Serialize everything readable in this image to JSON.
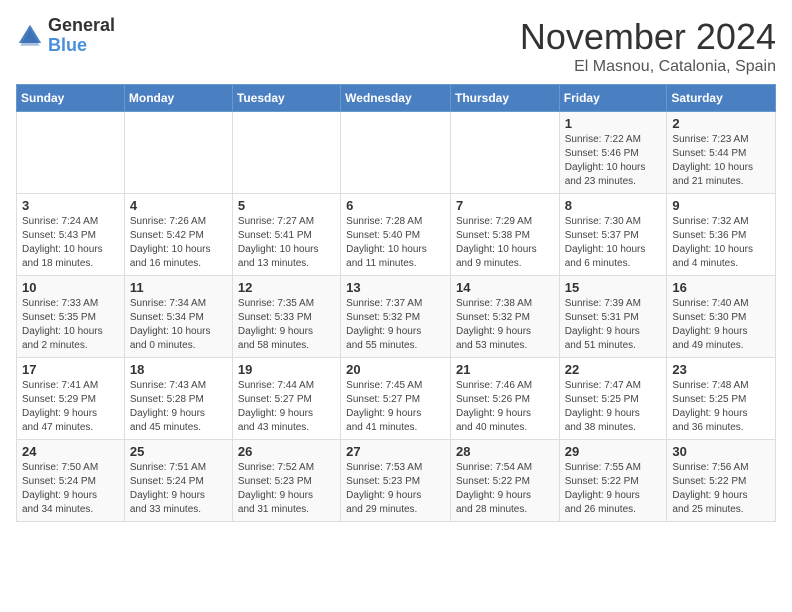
{
  "logo": {
    "line1": "General",
    "line2": "Blue"
  },
  "title": "November 2024",
  "location": "El Masnou, Catalonia, Spain",
  "days_header": [
    "Sunday",
    "Monday",
    "Tuesday",
    "Wednesday",
    "Thursday",
    "Friday",
    "Saturday"
  ],
  "weeks": [
    [
      {
        "day": "",
        "detail": ""
      },
      {
        "day": "",
        "detail": ""
      },
      {
        "day": "",
        "detail": ""
      },
      {
        "day": "",
        "detail": ""
      },
      {
        "day": "",
        "detail": ""
      },
      {
        "day": "1",
        "detail": "Sunrise: 7:22 AM\nSunset: 5:46 PM\nDaylight: 10 hours\nand 23 minutes."
      },
      {
        "day": "2",
        "detail": "Sunrise: 7:23 AM\nSunset: 5:44 PM\nDaylight: 10 hours\nand 21 minutes."
      }
    ],
    [
      {
        "day": "3",
        "detail": "Sunrise: 7:24 AM\nSunset: 5:43 PM\nDaylight: 10 hours\nand 18 minutes."
      },
      {
        "day": "4",
        "detail": "Sunrise: 7:26 AM\nSunset: 5:42 PM\nDaylight: 10 hours\nand 16 minutes."
      },
      {
        "day": "5",
        "detail": "Sunrise: 7:27 AM\nSunset: 5:41 PM\nDaylight: 10 hours\nand 13 minutes."
      },
      {
        "day": "6",
        "detail": "Sunrise: 7:28 AM\nSunset: 5:40 PM\nDaylight: 10 hours\nand 11 minutes."
      },
      {
        "day": "7",
        "detail": "Sunrise: 7:29 AM\nSunset: 5:38 PM\nDaylight: 10 hours\nand 9 minutes."
      },
      {
        "day": "8",
        "detail": "Sunrise: 7:30 AM\nSunset: 5:37 PM\nDaylight: 10 hours\nand 6 minutes."
      },
      {
        "day": "9",
        "detail": "Sunrise: 7:32 AM\nSunset: 5:36 PM\nDaylight: 10 hours\nand 4 minutes."
      }
    ],
    [
      {
        "day": "10",
        "detail": "Sunrise: 7:33 AM\nSunset: 5:35 PM\nDaylight: 10 hours\nand 2 minutes."
      },
      {
        "day": "11",
        "detail": "Sunrise: 7:34 AM\nSunset: 5:34 PM\nDaylight: 10 hours\nand 0 minutes."
      },
      {
        "day": "12",
        "detail": "Sunrise: 7:35 AM\nSunset: 5:33 PM\nDaylight: 9 hours\nand 58 minutes."
      },
      {
        "day": "13",
        "detail": "Sunrise: 7:37 AM\nSunset: 5:32 PM\nDaylight: 9 hours\nand 55 minutes."
      },
      {
        "day": "14",
        "detail": "Sunrise: 7:38 AM\nSunset: 5:32 PM\nDaylight: 9 hours\nand 53 minutes."
      },
      {
        "day": "15",
        "detail": "Sunrise: 7:39 AM\nSunset: 5:31 PM\nDaylight: 9 hours\nand 51 minutes."
      },
      {
        "day": "16",
        "detail": "Sunrise: 7:40 AM\nSunset: 5:30 PM\nDaylight: 9 hours\nand 49 minutes."
      }
    ],
    [
      {
        "day": "17",
        "detail": "Sunrise: 7:41 AM\nSunset: 5:29 PM\nDaylight: 9 hours\nand 47 minutes."
      },
      {
        "day": "18",
        "detail": "Sunrise: 7:43 AM\nSunset: 5:28 PM\nDaylight: 9 hours\nand 45 minutes."
      },
      {
        "day": "19",
        "detail": "Sunrise: 7:44 AM\nSunset: 5:27 PM\nDaylight: 9 hours\nand 43 minutes."
      },
      {
        "day": "20",
        "detail": "Sunrise: 7:45 AM\nSunset: 5:27 PM\nDaylight: 9 hours\nand 41 minutes."
      },
      {
        "day": "21",
        "detail": "Sunrise: 7:46 AM\nSunset: 5:26 PM\nDaylight: 9 hours\nand 40 minutes."
      },
      {
        "day": "22",
        "detail": "Sunrise: 7:47 AM\nSunset: 5:25 PM\nDaylight: 9 hours\nand 38 minutes."
      },
      {
        "day": "23",
        "detail": "Sunrise: 7:48 AM\nSunset: 5:25 PM\nDaylight: 9 hours\nand 36 minutes."
      }
    ],
    [
      {
        "day": "24",
        "detail": "Sunrise: 7:50 AM\nSunset: 5:24 PM\nDaylight: 9 hours\nand 34 minutes."
      },
      {
        "day": "25",
        "detail": "Sunrise: 7:51 AM\nSunset: 5:24 PM\nDaylight: 9 hours\nand 33 minutes."
      },
      {
        "day": "26",
        "detail": "Sunrise: 7:52 AM\nSunset: 5:23 PM\nDaylight: 9 hours\nand 31 minutes."
      },
      {
        "day": "27",
        "detail": "Sunrise: 7:53 AM\nSunset: 5:23 PM\nDaylight: 9 hours\nand 29 minutes."
      },
      {
        "day": "28",
        "detail": "Sunrise: 7:54 AM\nSunset: 5:22 PM\nDaylight: 9 hours\nand 28 minutes."
      },
      {
        "day": "29",
        "detail": "Sunrise: 7:55 AM\nSunset: 5:22 PM\nDaylight: 9 hours\nand 26 minutes."
      },
      {
        "day": "30",
        "detail": "Sunrise: 7:56 AM\nSunset: 5:22 PM\nDaylight: 9 hours\nand 25 minutes."
      }
    ]
  ]
}
